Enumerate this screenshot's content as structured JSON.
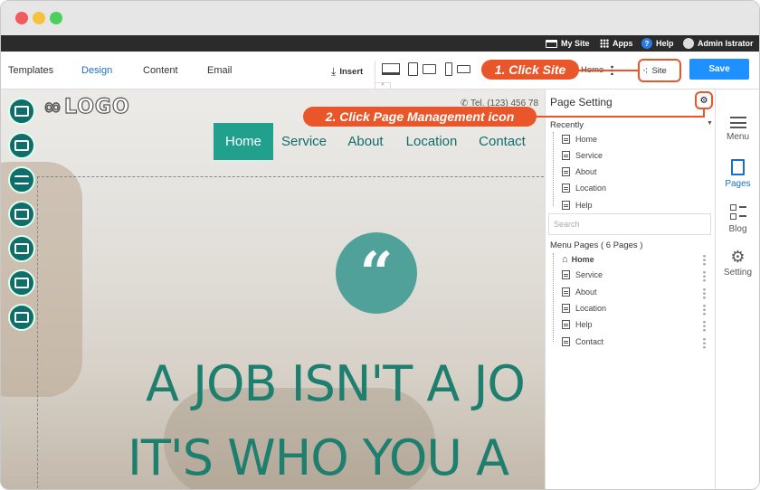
{
  "topbar": {
    "my_site": "My Site",
    "apps": "Apps",
    "help": "Help",
    "user": "Admin Istrator"
  },
  "toolbar": {
    "tabs": [
      "Templates",
      "Design",
      "Content",
      "Email"
    ],
    "active_tab": "Design",
    "insert": "Insert",
    "home": "Home",
    "site": "Site",
    "save": "Save"
  },
  "callouts": {
    "step1": "1. Click Site",
    "step2": "2. Click Page Management icon"
  },
  "site": {
    "logo": "LOGO",
    "phone": "Tel. (123) 456 78",
    "nav": [
      "Home",
      "Service",
      "About",
      "Location",
      "Contact"
    ],
    "active_nav": "Home",
    "quote_mark": "“",
    "hero_line1": "A JOB ISN'T A JO",
    "hero_line2": "IT'S WHO YOU A"
  },
  "panel": {
    "title": "Page Setting",
    "recently_label": "Recently",
    "recently": [
      "Home",
      "Service",
      "About",
      "Location",
      "Help"
    ],
    "search_placeholder": "Search",
    "menu_pages_label": "Menu Pages ( 6 Pages )",
    "menu_pages": [
      "Home",
      "Service",
      "About",
      "Location",
      "Help",
      "Contact"
    ]
  },
  "right_rail": {
    "items": [
      "Menu",
      "Pages",
      "Blog",
      "Setting"
    ],
    "active": "Pages"
  },
  "colors": {
    "accent": "#e8562a",
    "brand_teal": "#21a08d",
    "primary_blue": "#1e90ff"
  }
}
